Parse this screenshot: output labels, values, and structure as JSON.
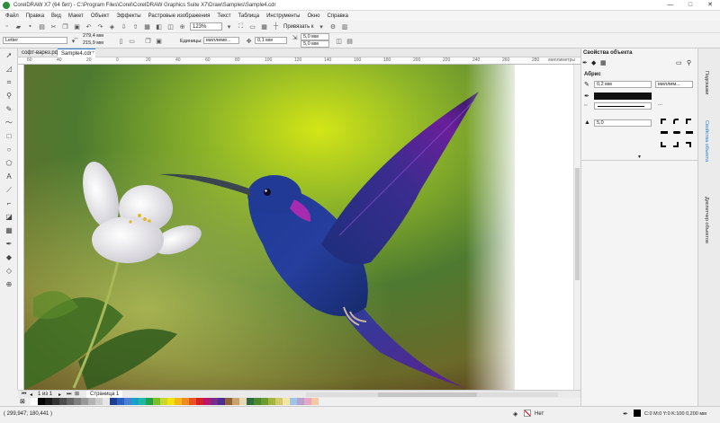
{
  "window": {
    "title": "CorelDRAW X7 (64 бит) - C:\\Program Files\\Corel\\CorelDRAW Graphics Suite X7\\Draw\\Samples\\Sample4.cdr",
    "minimize": "—",
    "maximize": "□",
    "close": "✕"
  },
  "menu": [
    "Файл",
    "Правка",
    "Вид",
    "Макет",
    "Объект",
    "Эффекты",
    "Растровые изображения",
    "Текст",
    "Таблица",
    "Инструменты",
    "Окно",
    "Справка"
  ],
  "toolbar": {
    "zoom": "123%",
    "snap_label": "Привязать к"
  },
  "property_bar": {
    "paper": "Letter",
    "width": "279,4 мм",
    "height": "215,9 мм",
    "units_label": "Единицы:",
    "units": "миллиме...",
    "nudge": "0,1 мм",
    "dup_x": "5,0 мм",
    "dup_y": "5,0 мм"
  },
  "tabs": [
    {
      "label": "софт-варез.рф"
    },
    {
      "label": "Sample4.cdr"
    }
  ],
  "ruler": {
    "unit": "миллиметры",
    "ticks": [
      "60",
      "40",
      "20",
      "0",
      "20",
      "40",
      "60",
      "80",
      "100",
      "120",
      "140",
      "160",
      "180",
      "200",
      "220",
      "240",
      "260",
      "280"
    ]
  },
  "page_nav": {
    "page_of": "1 из 1",
    "page_tab": "Страница 1"
  },
  "docker": {
    "title": "Свойства объекта",
    "section": "Абрис",
    "width": "0,2 мм",
    "units": "миллим...",
    "miter": "5,0",
    "vertical_tabs": [
      "Подсказки",
      "Свойства объекта",
      "Диспетчер объектов"
    ]
  },
  "palette": {
    "colors": [
      "#ffffff",
      "#000000",
      "#1a1a1a",
      "#333333",
      "#4d4d4d",
      "#666666",
      "#808080",
      "#999999",
      "#b3b3b3",
      "#cccccc",
      "#e6e6e6",
      "#1e3f8f",
      "#2d5fbf",
      "#4a7fd8",
      "#17a1c7",
      "#1fb7a5",
      "#22a04a",
      "#7cbf2b",
      "#c9d82c",
      "#f2e30f",
      "#f7b718",
      "#f08a1d",
      "#e8521f",
      "#d6202a",
      "#b5176b",
      "#7a2a8c",
      "#4f2d8f",
      "#8d6239",
      "#c9a36b",
      "#e8d7b5",
      "#2e6b3f",
      "#4a8a2c",
      "#6e9a32",
      "#a3b43b",
      "#d4c86a",
      "#f3e7a8",
      "#9ec4e8",
      "#b6a1d1",
      "#e7a6c2",
      "#f7c9a3"
    ]
  },
  "status": {
    "coords": "( 299,947; 180,441 )",
    "fill_none": "Нет",
    "color_info": "C:0 M:0 Y:0 K:100  0,200 мм"
  }
}
